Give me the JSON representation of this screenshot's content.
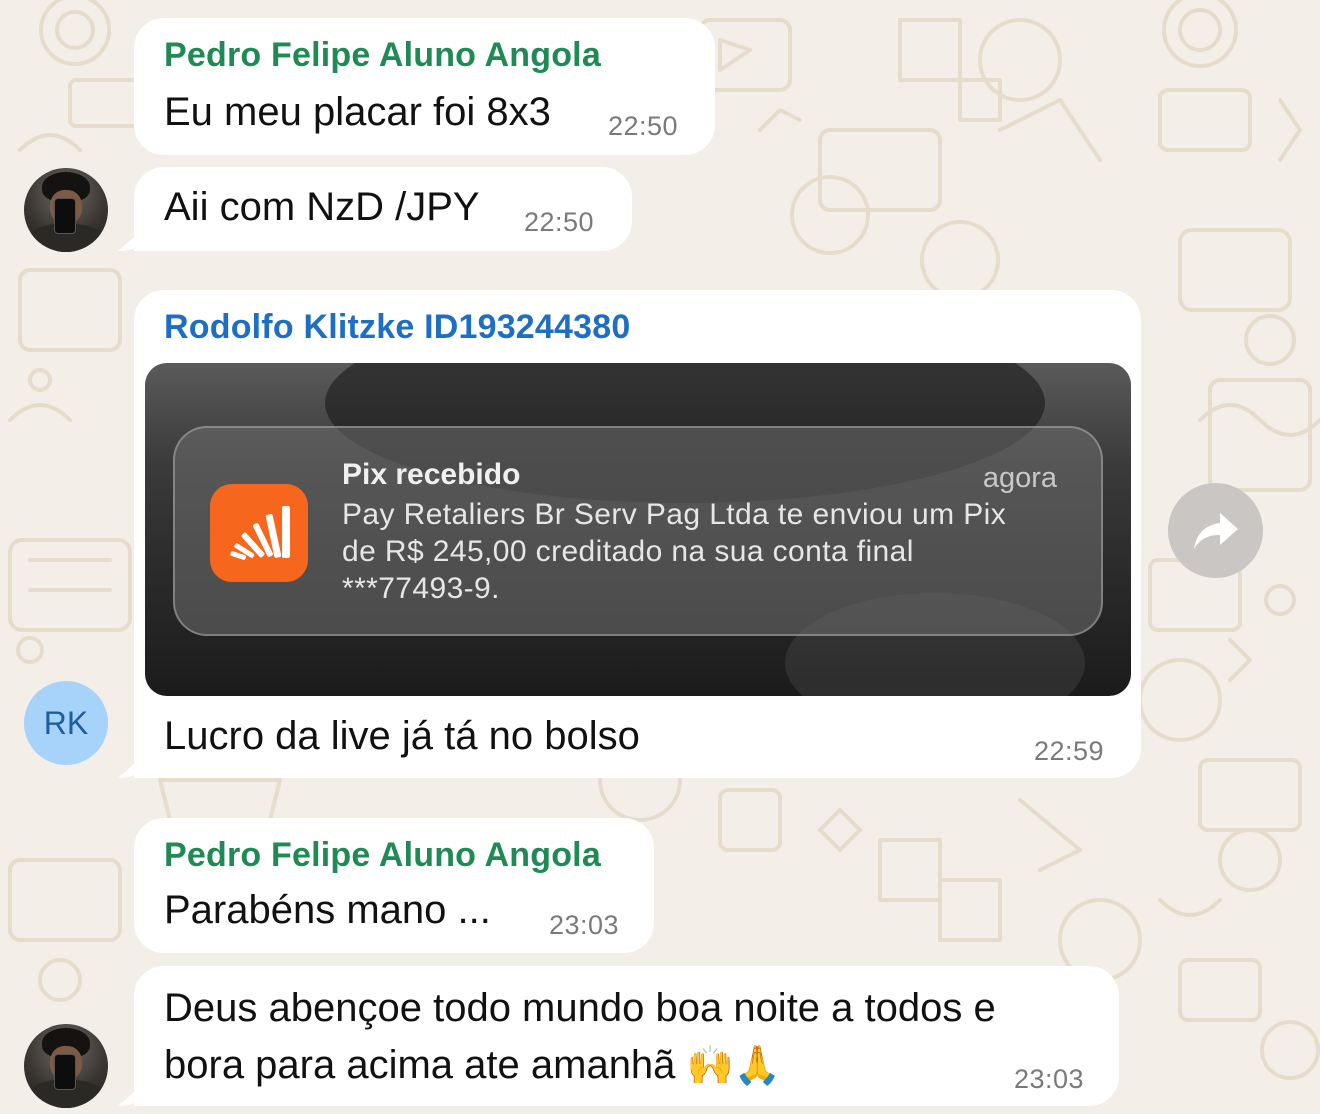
{
  "colors": {
    "wallpaper": "#f3efe8",
    "bubble": "#ffffff",
    "sender_green": "#1f8a53",
    "sender_blue": "#1e6fc3",
    "avatar_rk_bg": "#a7d3fb",
    "pix_orange": "#f7661d"
  },
  "messages": [
    {
      "sender": "Pedro Felipe Aluno Angola",
      "text": "Eu meu placar foi 8x3",
      "time": "22:50"
    },
    {
      "text": "Aii com NzD /JPY",
      "time": "22:50",
      "avatar": "profile-photo"
    },
    {
      "sender": "Rodolfo Klitzke ID193244380",
      "avatar_initials": "RK",
      "image": {
        "notification": {
          "app_icon": "pix-bank-icon",
          "title": "Pix recebido",
          "time": "agora",
          "body": "Pay Retaliers Br Serv Pag Ltda te enviou um Pix\nde R$ 245,00 creditado na sua conta final\n***77493-9."
        }
      },
      "text": "Lucro da live já tá no bolso",
      "time": "22:59",
      "forward_icon": "forward-arrow-icon"
    },
    {
      "sender": "Pedro Felipe Aluno Angola",
      "text": "Parabéns mano ...",
      "time": "23:03"
    },
    {
      "text_line1": "Deus abençoe todo mundo boa noite a  todos e",
      "text_line2": "bora para acima ate amanhã",
      "emojis": "🙌🙏",
      "time": "23:03",
      "avatar": "profile-photo"
    }
  ]
}
